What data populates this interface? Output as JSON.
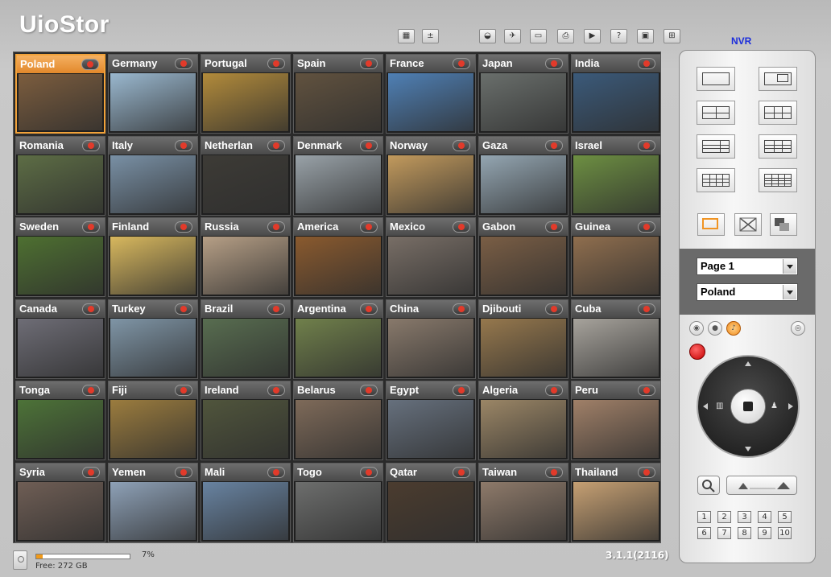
{
  "app": {
    "title": "UioStor"
  },
  "toolbar": {
    "left_icons": [
      "multi-view-icon",
      "options-icon"
    ],
    "right_icons": [
      "network-icon",
      "camera-setup-icon",
      "monitor-icon",
      "printer-icon",
      "play-icon",
      "help-icon",
      "system-icon"
    ]
  },
  "cameras": [
    "Poland",
    "Germany",
    "Portugal",
    "Spain",
    "France",
    "Japan",
    "India",
    "Romania",
    "Italy",
    "Netherlan",
    "Denmark",
    "Norway",
    "Gaza",
    "Israel",
    "Sweden",
    "Finland",
    "Russia",
    "America",
    "Mexico",
    "Gabon",
    "Guinea",
    "Canada",
    "Turkey",
    "Brazil",
    "Argentina",
    "China",
    "Djibouti",
    "Cuba",
    "Tonga",
    "Fiji",
    "Ireland",
    "Belarus",
    "Egypt",
    "Algeria",
    "Peru",
    "Syria",
    "Yemen",
    "Mali",
    "Togo",
    "Qatar",
    "Taiwan",
    "Thailand"
  ],
  "selected_camera": "Poland",
  "camera_thumbnail_colors": [
    "#7c5d3e",
    "#9ab8cf",
    "#b28b3b",
    "#61523f",
    "#4f80b5",
    "#6a6f6c",
    "#3b5a7a",
    "#5d6d45",
    "#7990a5",
    "#3d3b36",
    "#99a2a8",
    "#c29a5d",
    "#94a6b2",
    "#6d8f42",
    "#4e7031",
    "#d8b85e",
    "#b69f86",
    "#8a5a2e",
    "#786e66",
    "#7a5e45",
    "#8f6e4e",
    "#6e6d76",
    "#7f95a6",
    "#586d50",
    "#70804b",
    "#88796b",
    "#96784d",
    "#a7a39c",
    "#4d7338",
    "#9b7c3e",
    "#50553c",
    "#7e6a59",
    "#66707d",
    "#9b8666",
    "#a08068",
    "#6f5e55",
    "#8ea1b7",
    "#6883a1",
    "#6d6e6d",
    "#4b3c2f",
    "#8e7a6a",
    "#c6a073"
  ],
  "status": {
    "usage_percent": 7,
    "usage_label": "7%",
    "free_label": "Free: 272 GB",
    "version": "3.1.1(2116)"
  },
  "panel": {
    "nvr_label": "NVR",
    "page_select": "Page 1",
    "camera_select": "Poland",
    "numbers": [
      "1",
      "2",
      "3",
      "4",
      "5",
      "6",
      "7",
      "8",
      "9",
      "10"
    ]
  }
}
